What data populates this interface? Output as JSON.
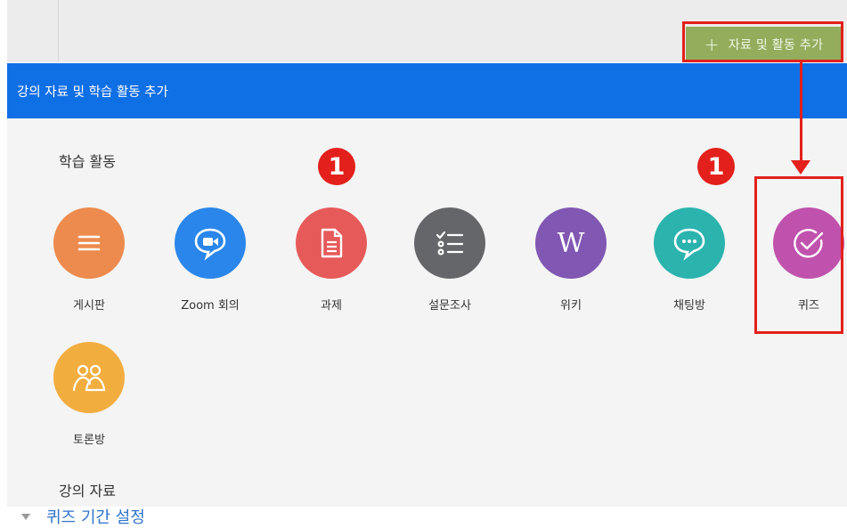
{
  "toolbar": {
    "add_button_label": "자료 및 활동 추가",
    "add_icon": "+"
  },
  "modal": {
    "title": "강의 자료 및 학습 활동 추가",
    "sections": {
      "activities_title": "학습 활동",
      "resources_title": "강의 자료"
    },
    "activities": [
      {
        "label": "게시판",
        "icon": "list-icon",
        "color": "#ed8b4e"
      },
      {
        "label": "Zoom 회의",
        "icon": "video-chat-icon",
        "color": "#2a86ea"
      },
      {
        "label": "과제",
        "icon": "document-icon",
        "color": "#e65a5a"
      },
      {
        "label": "설문조사",
        "icon": "checklist-icon",
        "color": "#65666a"
      },
      {
        "label": "위키",
        "icon": "wiki-icon",
        "color": "#8057b2"
      },
      {
        "label": "채팅방",
        "icon": "chat-icon",
        "color": "#2bb3ae"
      },
      {
        "label": "퀴즈",
        "icon": "check-circle-icon",
        "color": "#c052ad"
      },
      {
        "label": "토론방",
        "icon": "group-icon",
        "color": "#f2ad3f"
      }
    ]
  },
  "annotations": {
    "badge_1": "1",
    "badge_2": "1"
  },
  "below_section": {
    "label": "퀴즈 기간 설정"
  }
}
